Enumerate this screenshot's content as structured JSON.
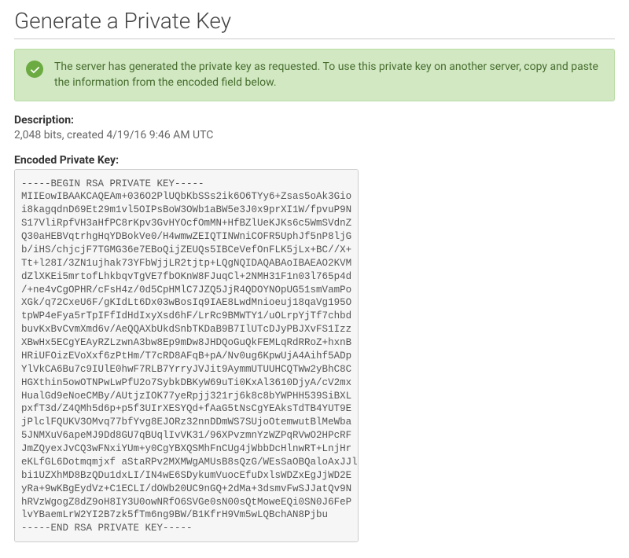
{
  "page": {
    "title": "Generate a Private Key"
  },
  "alert": {
    "message": "The server has generated the private key as requested. To use this private key on another server, copy and paste the information from the encoded field below."
  },
  "description": {
    "label": "Description:",
    "value": "2,048 bits, created 4/19/16 9:46 AM UTC"
  },
  "encodedKey": {
    "label": "Encoded Private Key:",
    "value": "-----BEGIN RSA PRIVATE KEY-----\nMIIEowIBAAKCAQEAm+036O2PlUQbKbSSs2ik6O6TYy6+Zsas5oAk3Gio\ni8kagqdnD69Et29m1vl5OIPsBoW3OWb1aBW5e3J0x9prXI1W/fpvuP9N\nS17VliRpfVH3aHfPC8rKpv3GvHYOcfOmMN+HfBZlUeKJKs6c5WmSVdnZ\nQ30aHEBVqtrhgHqYDBokVe0/H4wmwZEIQTINWniCOFR5UphJf5nP8ljG\nb/iHS/chjcjF7TGMG36e7EBoQijZEUQs5IBCeVefOnFLK5jLx+BC//X+\nTt+l28I/3ZN1ujhak73YFbWjjLR2tjtp+LQgNQIDAQABAoIBAEAO2KVM\ndZlXKEi5mrtofLhkbqvTgVE7fbOKnW8FJuqCl+2NMH31F1n03l765p4d\n/+ne4vCgOPHR/cFsH4z/0d5CpHMlC7JZQ5JjR4QDOYNOpUG51smVamPo\nXGk/q72CxeU6F/gKIdLt6Dx03wBosIq9IAE8LwdMnioeuj18qaVg195O\ntpWP4eFya5rTpIFfIdHdIxyXsd6hF/LrRc9BMWTY1/uOLrpYjTf7chbd\nbuvKxBvCvmXmd6v/AeQQAXbUkdSnbTKDaB9B7IlUTcDJyPBJXvFS1Izz\nXBwHx5ECgYEAyRZLzwnA3bw8Ep9mDw8JHDQoGuQkFEMLqRdRRoZ+hxnB\nHRiUFOizEVoXxf6zPtHm/T7cRD8AFqB+pA/Nv0ug6KpwUjA4Aihf5ADp\nYlVkCA6Bu7c9IUlE0hwF7RLB7YrryJVJit9AymmUTUUHCQTWw2yBhC8C\nHGXthin5owOTNPwLwPfU2o7SybkDBKyW69uTi0KxAl3610DjyA/cV2mx\nHualGd9eNoeCMBy/AUtjzIOK77yeRpjj321rj6k8c8bYWPHH539SiBXL\npxfT3d/Z4QMh5d6p+p5f3UIrXESYQd+fAaG5tNsCgYEAksTdTB4YUT9E\njPlclFQUKV3OMvq77bfYvg8EJORz32nnDDmWS7SUjoOtemwutBlMeWba\n5JNMXuV6apeMJ9Dd8GU7qBUqlIvVK31/96XPvzmnYzWZPqRVwO2HPcRF\nJmZQyexJvCQ3wFNxiYUm+y0CgYBXQSMhFnCUg4jWbbDcHlnwRT+LnjHr\neKLfGL6Dotmqmjxf aStaRPv2MXMWgAMUsB8sQzG/WEsSaOBQaloAxJJl\nbi1UZXhMD8BzQDu1dxLI/IN4wE6SDykumVuocEfuDxlsWDZxEgJjWD2E\nyRa+9wKBgEydVz+C1ECLI/dOWb20UC9nGQ+2dMa+3dsmvFwSJJatQv9N\nhRVzWgogZ8dZ9oH8IY3U0owNRfO6SVGe0sN00sQtMoweEQi0SN0J6FeP\nlvYBaemLrW2YI2B7zk5fTm6ng9BW/B1KfrH9Vm5wLQBchAN8Pjbu\n-----END RSA PRIVATE KEY-----"
  }
}
